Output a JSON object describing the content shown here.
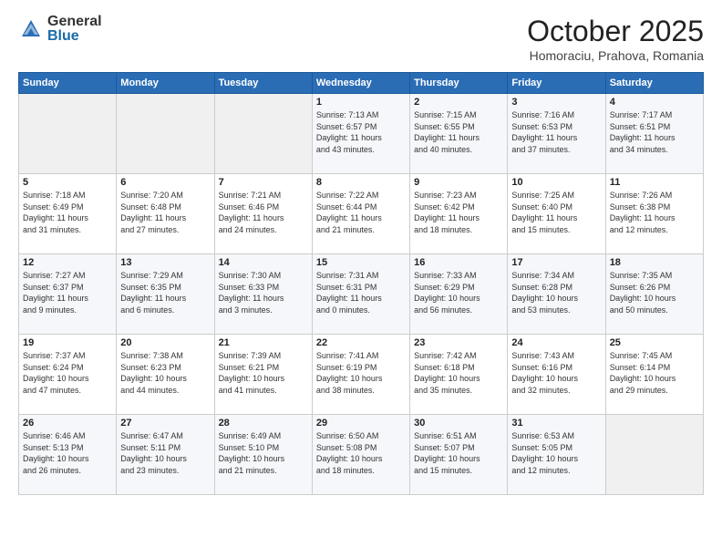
{
  "header": {
    "logo_general": "General",
    "logo_blue": "Blue",
    "month_title": "October 2025",
    "location": "Homoraciu, Prahova, Romania"
  },
  "days_of_week": [
    "Sunday",
    "Monday",
    "Tuesday",
    "Wednesday",
    "Thursday",
    "Friday",
    "Saturday"
  ],
  "weeks": [
    [
      {
        "day": "",
        "info": ""
      },
      {
        "day": "",
        "info": ""
      },
      {
        "day": "",
        "info": ""
      },
      {
        "day": "1",
        "info": "Sunrise: 7:13 AM\nSunset: 6:57 PM\nDaylight: 11 hours\nand 43 minutes."
      },
      {
        "day": "2",
        "info": "Sunrise: 7:15 AM\nSunset: 6:55 PM\nDaylight: 11 hours\nand 40 minutes."
      },
      {
        "day": "3",
        "info": "Sunrise: 7:16 AM\nSunset: 6:53 PM\nDaylight: 11 hours\nand 37 minutes."
      },
      {
        "day": "4",
        "info": "Sunrise: 7:17 AM\nSunset: 6:51 PM\nDaylight: 11 hours\nand 34 minutes."
      }
    ],
    [
      {
        "day": "5",
        "info": "Sunrise: 7:18 AM\nSunset: 6:49 PM\nDaylight: 11 hours\nand 31 minutes."
      },
      {
        "day": "6",
        "info": "Sunrise: 7:20 AM\nSunset: 6:48 PM\nDaylight: 11 hours\nand 27 minutes."
      },
      {
        "day": "7",
        "info": "Sunrise: 7:21 AM\nSunset: 6:46 PM\nDaylight: 11 hours\nand 24 minutes."
      },
      {
        "day": "8",
        "info": "Sunrise: 7:22 AM\nSunset: 6:44 PM\nDaylight: 11 hours\nand 21 minutes."
      },
      {
        "day": "9",
        "info": "Sunrise: 7:23 AM\nSunset: 6:42 PM\nDaylight: 11 hours\nand 18 minutes."
      },
      {
        "day": "10",
        "info": "Sunrise: 7:25 AM\nSunset: 6:40 PM\nDaylight: 11 hours\nand 15 minutes."
      },
      {
        "day": "11",
        "info": "Sunrise: 7:26 AM\nSunset: 6:38 PM\nDaylight: 11 hours\nand 12 minutes."
      }
    ],
    [
      {
        "day": "12",
        "info": "Sunrise: 7:27 AM\nSunset: 6:37 PM\nDaylight: 11 hours\nand 9 minutes."
      },
      {
        "day": "13",
        "info": "Sunrise: 7:29 AM\nSunset: 6:35 PM\nDaylight: 11 hours\nand 6 minutes."
      },
      {
        "day": "14",
        "info": "Sunrise: 7:30 AM\nSunset: 6:33 PM\nDaylight: 11 hours\nand 3 minutes."
      },
      {
        "day": "15",
        "info": "Sunrise: 7:31 AM\nSunset: 6:31 PM\nDaylight: 11 hours\nand 0 minutes."
      },
      {
        "day": "16",
        "info": "Sunrise: 7:33 AM\nSunset: 6:29 PM\nDaylight: 10 hours\nand 56 minutes."
      },
      {
        "day": "17",
        "info": "Sunrise: 7:34 AM\nSunset: 6:28 PM\nDaylight: 10 hours\nand 53 minutes."
      },
      {
        "day": "18",
        "info": "Sunrise: 7:35 AM\nSunset: 6:26 PM\nDaylight: 10 hours\nand 50 minutes."
      }
    ],
    [
      {
        "day": "19",
        "info": "Sunrise: 7:37 AM\nSunset: 6:24 PM\nDaylight: 10 hours\nand 47 minutes."
      },
      {
        "day": "20",
        "info": "Sunrise: 7:38 AM\nSunset: 6:23 PM\nDaylight: 10 hours\nand 44 minutes."
      },
      {
        "day": "21",
        "info": "Sunrise: 7:39 AM\nSunset: 6:21 PM\nDaylight: 10 hours\nand 41 minutes."
      },
      {
        "day": "22",
        "info": "Sunrise: 7:41 AM\nSunset: 6:19 PM\nDaylight: 10 hours\nand 38 minutes."
      },
      {
        "day": "23",
        "info": "Sunrise: 7:42 AM\nSunset: 6:18 PM\nDaylight: 10 hours\nand 35 minutes."
      },
      {
        "day": "24",
        "info": "Sunrise: 7:43 AM\nSunset: 6:16 PM\nDaylight: 10 hours\nand 32 minutes."
      },
      {
        "day": "25",
        "info": "Sunrise: 7:45 AM\nSunset: 6:14 PM\nDaylight: 10 hours\nand 29 minutes."
      }
    ],
    [
      {
        "day": "26",
        "info": "Sunrise: 6:46 AM\nSunset: 5:13 PM\nDaylight: 10 hours\nand 26 minutes."
      },
      {
        "day": "27",
        "info": "Sunrise: 6:47 AM\nSunset: 5:11 PM\nDaylight: 10 hours\nand 23 minutes."
      },
      {
        "day": "28",
        "info": "Sunrise: 6:49 AM\nSunset: 5:10 PM\nDaylight: 10 hours\nand 21 minutes."
      },
      {
        "day": "29",
        "info": "Sunrise: 6:50 AM\nSunset: 5:08 PM\nDaylight: 10 hours\nand 18 minutes."
      },
      {
        "day": "30",
        "info": "Sunrise: 6:51 AM\nSunset: 5:07 PM\nDaylight: 10 hours\nand 15 minutes."
      },
      {
        "day": "31",
        "info": "Sunrise: 6:53 AM\nSunset: 5:05 PM\nDaylight: 10 hours\nand 12 minutes."
      },
      {
        "day": "",
        "info": ""
      }
    ]
  ]
}
